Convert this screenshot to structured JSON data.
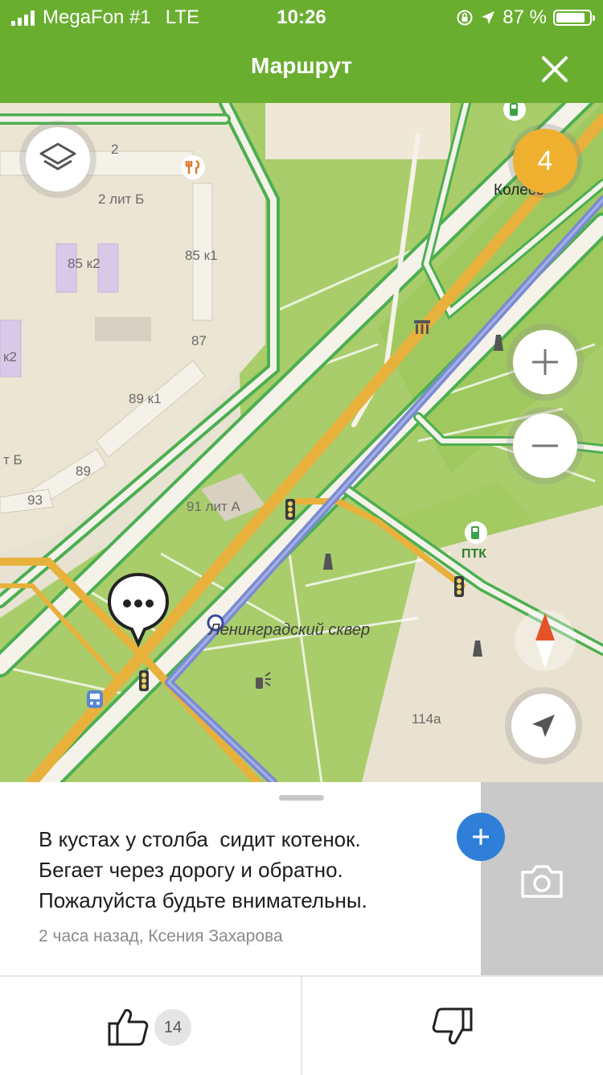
{
  "status_bar": {
    "carrier": "MegaFon #1",
    "network": "LTE",
    "time": "10:26",
    "battery_text": "87 %",
    "battery_level": 0.87
  },
  "header": {
    "title": "Маршрут",
    "close_icon": "close-icon"
  },
  "map": {
    "cluster_count": "4",
    "labels": {
      "house_2": "2",
      "house_2b": "2 лит Б",
      "house_85k2": "85 к2",
      "house_85k1": "85 к1",
      "house_87": "87",
      "house_k2": "к2",
      "house_89k1": "89 к1",
      "house_b": "т Б",
      "house_89": "89",
      "house_93": "93",
      "house_91a": "91 лит А",
      "park": "Ленинградский сквер",
      "ptk": "ПТК",
      "koleso": "Колесо",
      "house_114a": "114а"
    },
    "colors": {
      "park": "#a9cd6b",
      "road_green": "#4caf50",
      "road_yellow": "#e8b13c",
      "route_blue": "#7b8bd1"
    }
  },
  "post": {
    "lines": [
      "В кустах у столба  сидит котенок.",
      "Бегает через дорогу и обратно.",
      "Пожалуйста будьте внимательны."
    ],
    "meta": "2 часа назад, Ксения Захарова"
  },
  "actions": {
    "likes": "14"
  }
}
